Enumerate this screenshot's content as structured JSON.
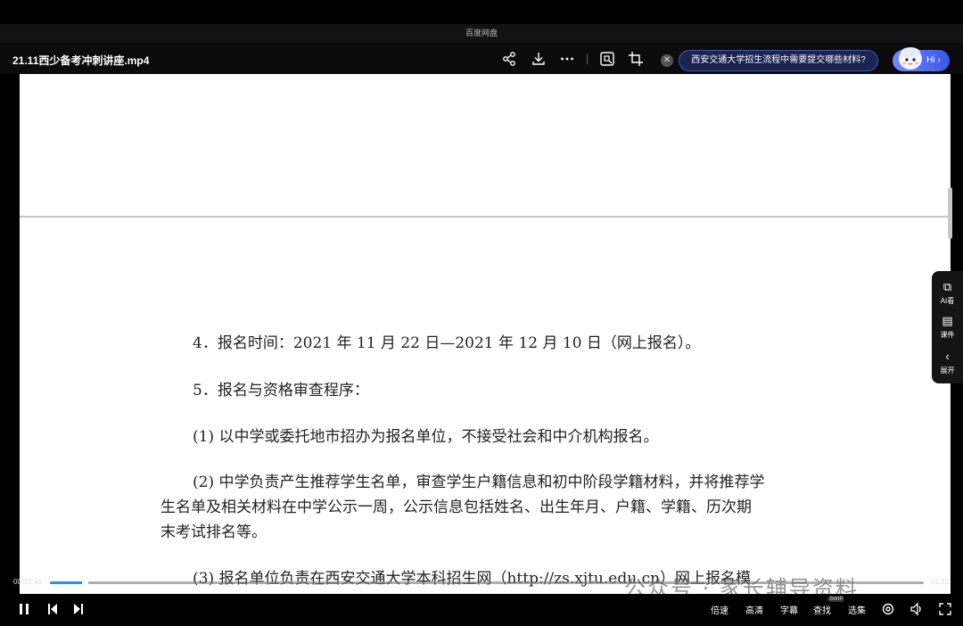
{
  "window": {
    "app_title": "百度网盘"
  },
  "toolbar": {
    "file_name": "21.11西少备考冲刺讲座.mp4",
    "icons": [
      "share-icon",
      "download-icon",
      "more-icon",
      "screenshot-icon",
      "crop-icon"
    ],
    "close_glyph": "✕",
    "ai_question": "西安交通大学招生流程中需要提交哪些材料?",
    "hi_label": "Hi ›"
  },
  "document": {
    "lines": [
      "4．报名时间：2021 年 11 月 22 日—2021 年 12 月 10 日（网上报名）。",
      "5．报名与资格审查程序：",
      "(1) 以中学或委托地市招办为报名单位，不接受社会和中介机构报名。",
      "(2) 中学负责产生推荐学生名单，审查学生户籍信息和初中阶段学籍材料，并将推荐学",
      "生名单及相关材料在中学公示一周，公示信息包括姓名、出生年月、户籍、学籍、历次期",
      "末考试排名等。",
      "(3) 报名单位负责在西安交通大学本科招生网（http://zs.xjtu.edu.cn）网上报名模"
    ]
  },
  "side_panel": {
    "items": [
      {
        "label": "AI看",
        "icon": "ai-watch-icon",
        "glyph": "⧉"
      },
      {
        "label": "课件",
        "icon": "courseware-icon",
        "glyph": "▤"
      },
      {
        "label": "展开",
        "icon": "expand-icon",
        "glyph": "‹"
      }
    ]
  },
  "watermark": "公众号 · 家长辅导资料",
  "player": {
    "time_current": "00:03:40",
    "time_total": "01:33",
    "progress_fraction": 0.04,
    "controls": [
      "倍速",
      "高清",
      "字幕",
      "查找",
      "选集"
    ],
    "search_badge": "SWIP",
    "accent": "#2f8cff"
  }
}
